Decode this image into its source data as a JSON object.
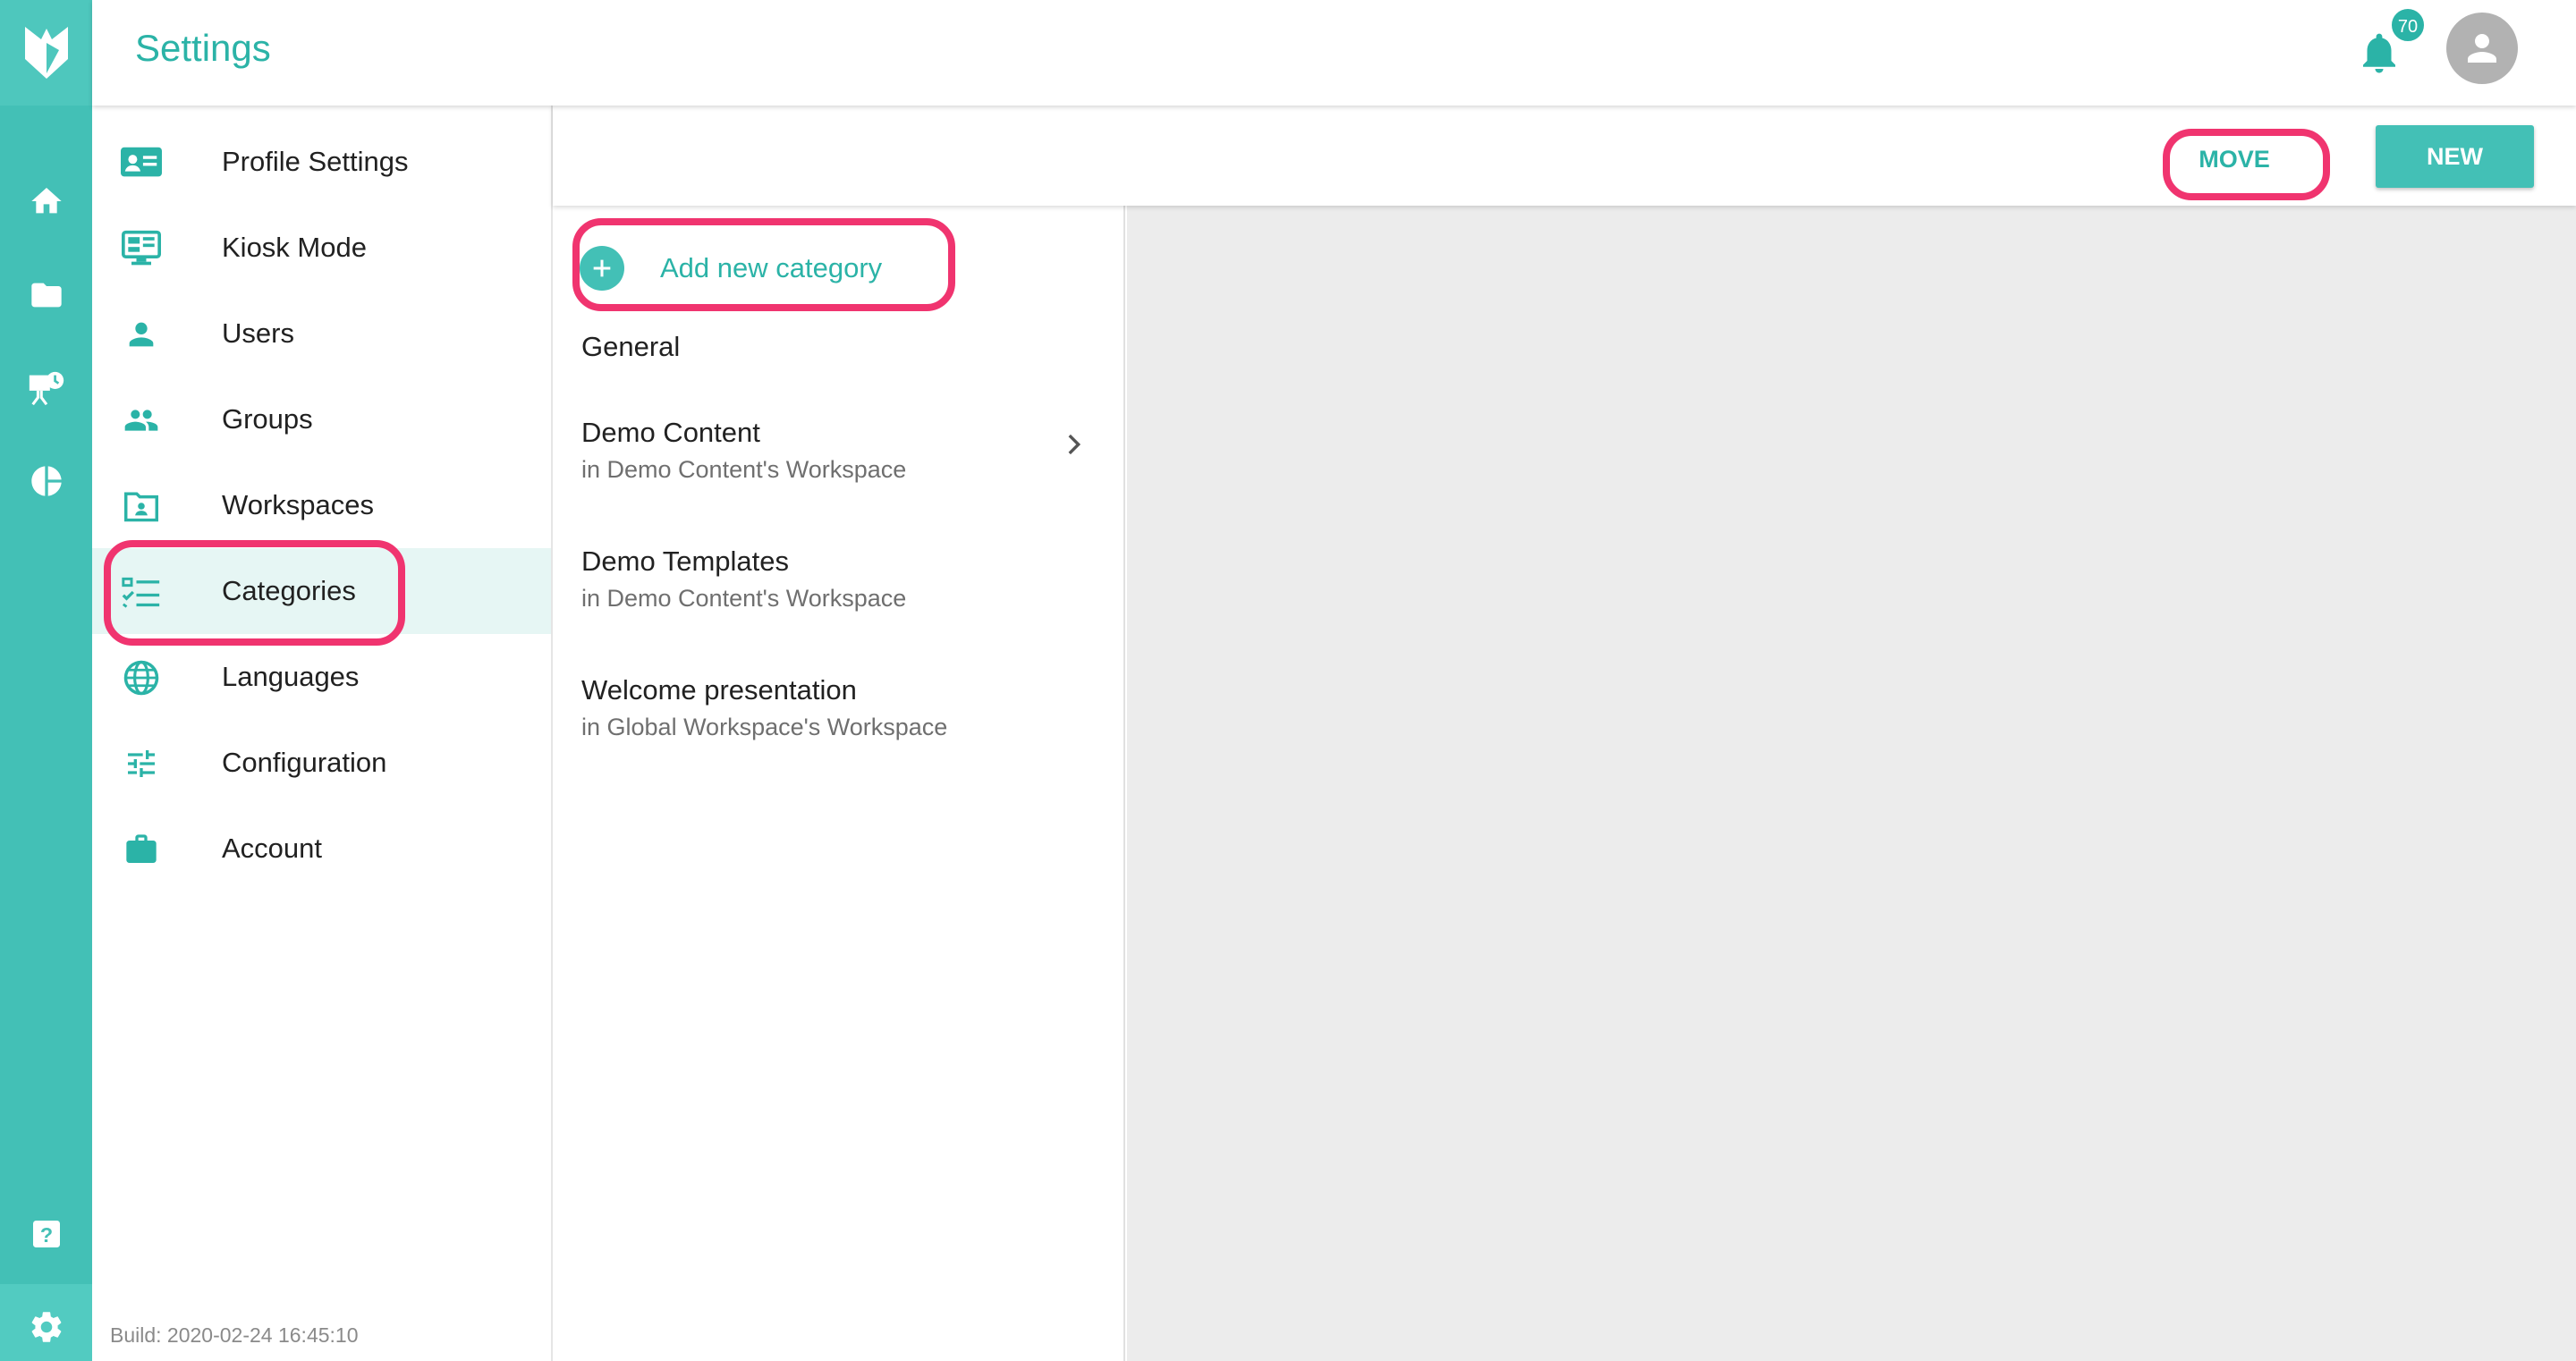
{
  "header": {
    "title": "Settings",
    "notification_count": "70"
  },
  "rail": {
    "icons": [
      "logo-icon",
      "home-icon",
      "folder-icon",
      "presentation-icon",
      "pie-chart-icon",
      "help-icon",
      "gear-icon"
    ]
  },
  "sidebar": {
    "items": [
      {
        "label": "Profile Settings",
        "icon": "profile-card-icon"
      },
      {
        "label": "Kiosk Mode",
        "icon": "kiosk-monitor-icon"
      },
      {
        "label": "Users",
        "icon": "user-icon"
      },
      {
        "label": "Groups",
        "icon": "group-icon"
      },
      {
        "label": "Workspaces",
        "icon": "workspace-folder-icon"
      },
      {
        "label": "Categories",
        "icon": "checklist-icon",
        "active": true
      },
      {
        "label": "Languages",
        "icon": "globe-icon"
      },
      {
        "label": "Configuration",
        "icon": "sliders-icon"
      },
      {
        "label": "Account",
        "icon": "briefcase-icon"
      }
    ],
    "build": "Build: 2020-02-24 16:45:10"
  },
  "toolbar": {
    "move_label": "MOVE",
    "new_label": "NEW"
  },
  "categories": {
    "add_label": "Add new category",
    "items": [
      {
        "name": "General",
        "sub": ""
      },
      {
        "name": "Demo Content",
        "sub": "in Demo Content's Workspace"
      },
      {
        "name": "Demo Templates",
        "sub": "in Demo Content's Workspace"
      },
      {
        "name": "Welcome presentation",
        "sub": "in Global Workspace's Workspace"
      }
    ]
  },
  "colors": {
    "brand": "#43c0b6",
    "brand_text": "#2bb3a7",
    "highlight": "#f0346f",
    "active_bg": "#e6f6f4"
  }
}
